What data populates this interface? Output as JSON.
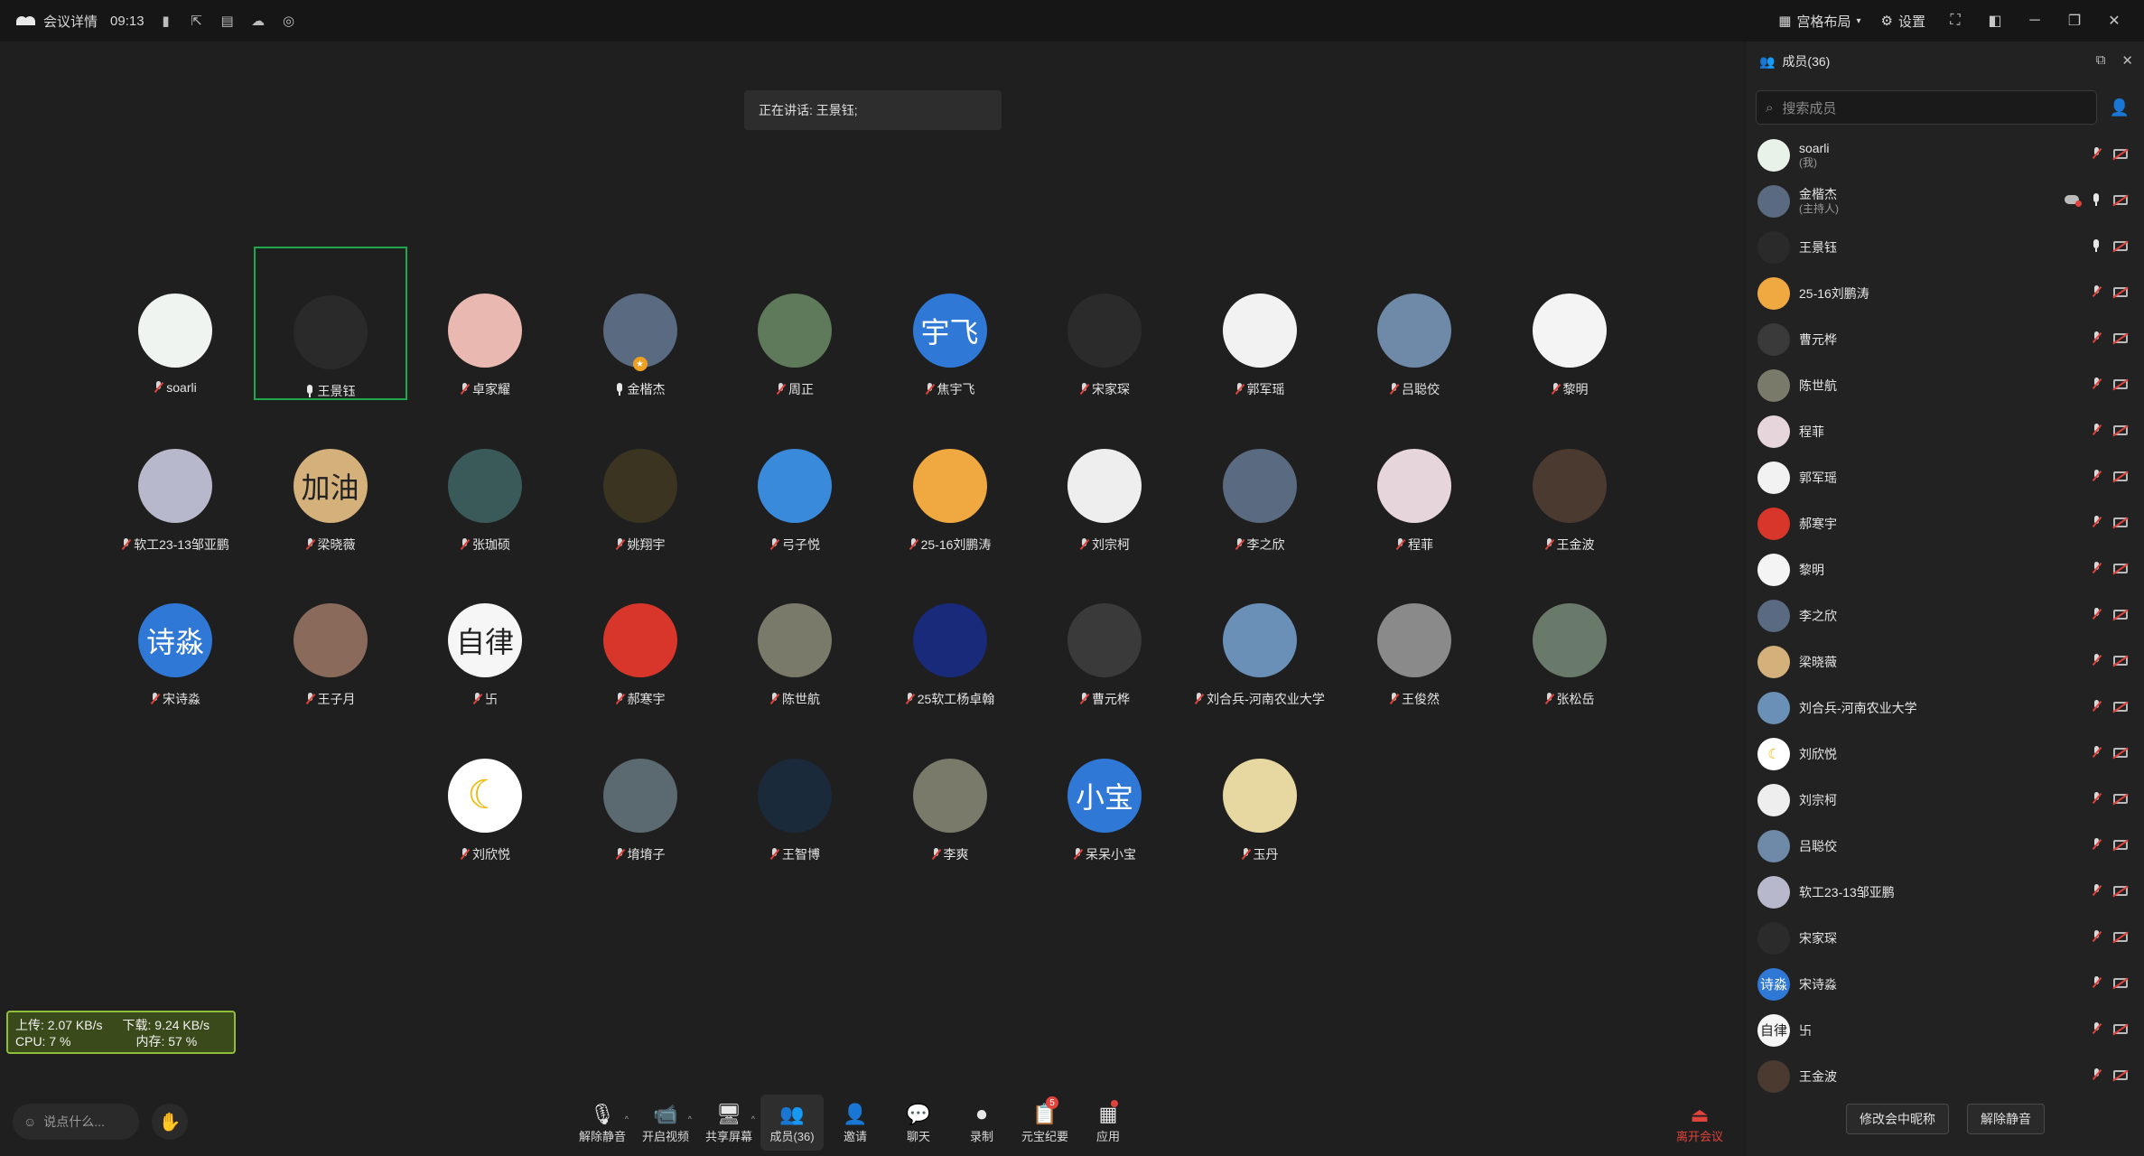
{
  "titlebar": {
    "title": "会议详情",
    "time": "09:13",
    "layout_label": "宫格布局",
    "settings_label": "设置"
  },
  "speaking": "正在讲话: 王景钰;",
  "participants": [
    {
      "name": "soarli",
      "mic": "muted",
      "avatar_color": "#f0f4f0",
      "avatar_text": ""
    },
    {
      "name": "王景钰",
      "mic": "on",
      "avatar_color": "#2a2a2a",
      "avatar_text": "",
      "active": true
    },
    {
      "name": "卓家耀",
      "mic": "muted",
      "avatar_color": "#e9b8b0",
      "avatar_text": ""
    },
    {
      "name": "金楷杰",
      "mic": "on",
      "avatar_color": "#5a6a80",
      "avatar_text": "",
      "host": true
    },
    {
      "name": "周正",
      "mic": "muted",
      "avatar_color": "#5f7a5a",
      "avatar_text": ""
    },
    {
      "name": "焦宇飞",
      "mic": "muted",
      "avatar_color": "#2f78d6",
      "avatar_text": "宇飞"
    },
    {
      "name": "宋家琛",
      "mic": "muted",
      "avatar_color": "#2b2b2b",
      "avatar_text": ""
    },
    {
      "name": "郭军瑶",
      "mic": "muted",
      "avatar_color": "#f2f2f2",
      "avatar_text": ""
    },
    {
      "name": "吕聪佼",
      "mic": "muted",
      "avatar_color": "#6f8aa8",
      "avatar_text": ""
    },
    {
      "name": "黎明",
      "mic": "muted",
      "avatar_color": "#f4f4f4",
      "avatar_text": ""
    },
    {
      "name": "软工23-13邹亚鹏",
      "mic": "muted",
      "avatar_color": "#b8b8cc",
      "avatar_text": ""
    },
    {
      "name": "梁晓薇",
      "mic": "muted",
      "avatar_color": "#d4b07a",
      "avatar_text": "加油"
    },
    {
      "name": "张珈硕",
      "mic": "muted",
      "avatar_color": "#3a5a5a",
      "avatar_text": ""
    },
    {
      "name": "姚翔宇",
      "mic": "muted",
      "avatar_color": "#3a3420",
      "avatar_text": ""
    },
    {
      "name": "弓子悦",
      "mic": "muted",
      "avatar_color": "#3a8adc",
      "avatar_text": ""
    },
    {
      "name": "25-16刘鹏涛",
      "mic": "muted",
      "avatar_color": "#f0a840",
      "avatar_text": ""
    },
    {
      "name": "刘宗柯",
      "mic": "muted",
      "avatar_color": "#eeeeee",
      "avatar_text": ""
    },
    {
      "name": "李之欣",
      "mic": "muted",
      "avatar_color": "#5a6a80",
      "avatar_text": ""
    },
    {
      "name": "程菲",
      "mic": "muted",
      "avatar_color": "#e6d6dc",
      "avatar_text": ""
    },
    {
      "name": "王金波",
      "mic": "muted",
      "avatar_color": "#4a3a30",
      "avatar_text": ""
    },
    {
      "name": "宋诗淼",
      "mic": "muted",
      "avatar_color": "#2f78d6",
      "avatar_text": "诗淼"
    },
    {
      "name": "王子月",
      "mic": "muted",
      "avatar_color": "#8a6a5a",
      "avatar_text": ""
    },
    {
      "name": "卐",
      "mic": "muted",
      "avatar_color": "#f6f6f6",
      "avatar_text": "自律"
    },
    {
      "name": "郝寒宇",
      "mic": "muted",
      "avatar_color": "#d8362a",
      "avatar_text": ""
    },
    {
      "name": "陈世航",
      "mic": "muted",
      "avatar_color": "#7a7a6a",
      "avatar_text": ""
    },
    {
      "name": "25软工杨卓翰",
      "mic": "muted",
      "avatar_color": "#1a2a7a",
      "avatar_text": ""
    },
    {
      "name": "曹元桦",
      "mic": "muted",
      "avatar_color": "#3a3a3a",
      "avatar_text": ""
    },
    {
      "name": "刘合兵-河南农业大学",
      "mic": "muted",
      "avatar_color": "#6a90b8",
      "avatar_text": ""
    },
    {
      "name": "王俊然",
      "mic": "muted",
      "avatar_color": "#8a8a8a",
      "avatar_text": ""
    },
    {
      "name": "张松岳",
      "mic": "muted",
      "avatar_color": "#6a7a6a",
      "avatar_text": ""
    },
    {
      "name": "刘欣悦",
      "mic": "muted",
      "avatar_color": "#ffffff",
      "avatar_text": "☾"
    },
    {
      "name": "堉堉子",
      "mic": "muted",
      "avatar_color": "#5a6a70",
      "avatar_text": ""
    },
    {
      "name": "王智博",
      "mic": "muted",
      "avatar_color": "#1a2a3a",
      "avatar_text": ""
    },
    {
      "name": "李爽",
      "mic": "muted",
      "avatar_color": "#7a7a6a",
      "avatar_text": ""
    },
    {
      "name": "呆呆小宝",
      "mic": "muted",
      "avatar_color": "#2f78d6",
      "avatar_text": "小宝"
    },
    {
      "name": "玉丹",
      "mic": "muted",
      "avatar_color": "#e6d8a0",
      "avatar_text": ""
    }
  ],
  "netmon": {
    "upload": "上传: 2.07 KB/s",
    "download": "下载: 9.24 KB/s",
    "cpu": "CPU: 7 %",
    "mem": "内存: 57 %"
  },
  "chat_placeholder": "说点什么...",
  "toolbar": [
    {
      "label": "解除静音",
      "icon": "🎙",
      "caret": true
    },
    {
      "label": "开启视频",
      "icon": "📹",
      "caret": true
    },
    {
      "label": "共享屏幕",
      "icon": "🖥",
      "caret": true
    },
    {
      "label": "成员(36)",
      "icon": "👥",
      "selected": true
    },
    {
      "label": "邀请",
      "icon": "👤"
    },
    {
      "label": "聊天",
      "icon": "💬"
    },
    {
      "label": "录制",
      "icon": "⏺"
    },
    {
      "label": "元宝纪要",
      "icon": "📋",
      "badge": "5"
    },
    {
      "label": "应用",
      "icon": "▦",
      "dot": true
    }
  ],
  "leave_label": "离开会议",
  "panel": {
    "title": "成员(36)",
    "search_placeholder": "搜索成员",
    "members": [
      {
        "name": "soarli",
        "role": "(我)",
        "avatar_color": "#e8f2e8",
        "avatar_text": "",
        "mic": "muted",
        "cloud": false
      },
      {
        "name": "金楷杰",
        "role": "(主持人)",
        "avatar_color": "#5a6a80",
        "avatar_text": "",
        "mic": "on",
        "cloud": true
      },
      {
        "name": "王景钰",
        "role": "",
        "avatar_color": "#2a2a2a",
        "avatar_text": "",
        "mic": "on",
        "cloud": false
      },
      {
        "name": "25-16刘鹏涛",
        "role": "",
        "avatar_color": "#f0a840",
        "avatar_text": "",
        "mic": "muted",
        "cloud": false
      },
      {
        "name": "曹元桦",
        "role": "",
        "avatar_color": "#3a3a3a",
        "avatar_text": "",
        "mic": "muted",
        "cloud": false
      },
      {
        "name": "陈世航",
        "role": "",
        "avatar_color": "#7a7a6a",
        "avatar_text": "",
        "mic": "muted",
        "cloud": false
      },
      {
        "name": "程菲",
        "role": "",
        "avatar_color": "#e6d6dc",
        "avatar_text": "",
        "mic": "muted",
        "cloud": false
      },
      {
        "name": "郭军瑶",
        "role": "",
        "avatar_color": "#f2f2f2",
        "avatar_text": "",
        "mic": "muted",
        "cloud": false
      },
      {
        "name": "郝寒宇",
        "role": "",
        "avatar_color": "#d8362a",
        "avatar_text": "",
        "mic": "muted",
        "cloud": false
      },
      {
        "name": "黎明",
        "role": "",
        "avatar_color": "#f4f4f4",
        "avatar_text": "",
        "mic": "muted",
        "cloud": false
      },
      {
        "name": "李之欣",
        "role": "",
        "avatar_color": "#5a6a80",
        "avatar_text": "",
        "mic": "muted",
        "cloud": false
      },
      {
        "name": "梁晓薇",
        "role": "",
        "avatar_color": "#d4b07a",
        "avatar_text": "",
        "mic": "muted",
        "cloud": false
      },
      {
        "name": "刘合兵-河南农业大学",
        "role": "",
        "avatar_color": "#6a90b8",
        "avatar_text": "",
        "mic": "muted",
        "cloud": false
      },
      {
        "name": "刘欣悦",
        "role": "",
        "avatar_color": "#ffffff",
        "avatar_text": "☾",
        "mic": "muted",
        "cloud": false
      },
      {
        "name": "刘宗柯",
        "role": "",
        "avatar_color": "#eeeeee",
        "avatar_text": "",
        "mic": "muted",
        "cloud": false
      },
      {
        "name": "吕聪佼",
        "role": "",
        "avatar_color": "#6f8aa8",
        "avatar_text": "",
        "mic": "muted",
        "cloud": false
      },
      {
        "name": "软工23-13邹亚鹏",
        "role": "",
        "avatar_color": "#b8b8cc",
        "avatar_text": "",
        "mic": "muted",
        "cloud": false
      },
      {
        "name": "宋家琛",
        "role": "",
        "avatar_color": "#2b2b2b",
        "avatar_text": "",
        "mic": "muted",
        "cloud": false
      },
      {
        "name": "宋诗淼",
        "role": "",
        "avatar_color": "#2f78d6",
        "avatar_text": "诗淼",
        "mic": "muted",
        "cloud": false
      },
      {
        "name": "卐",
        "role": "",
        "avatar_color": "#f6f6f6",
        "avatar_text": "自律",
        "mic": "muted",
        "cloud": false
      },
      {
        "name": "王金波",
        "role": "",
        "avatar_color": "#4a3a30",
        "avatar_text": "",
        "mic": "muted",
        "cloud": false
      }
    ],
    "rename_label": "修改会中昵称",
    "unmute_label": "解除静音"
  }
}
